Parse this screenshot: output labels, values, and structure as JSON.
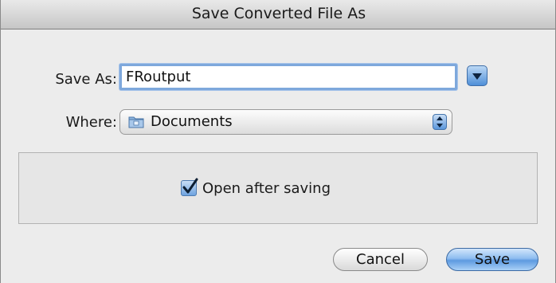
{
  "window": {
    "title": "Save Converted File As"
  },
  "form": {
    "save_as_label": "Save As:",
    "filename_value": "FRoutput",
    "where_label": "Where:",
    "where_value": "Documents",
    "folder_icon": "folder-icon",
    "disclosure_icon": "chevron-down-icon",
    "popup_icon": "up-down-stepper-icon"
  },
  "options": {
    "open_after_saving_label": "Open after saving",
    "open_after_saving_checked": true
  },
  "buttons": {
    "cancel_label": "Cancel",
    "save_label": "Save"
  },
  "colors": {
    "accent": "#5d9ae0",
    "focus_ring": "#7ea8dc",
    "window_bg": "#ececec"
  }
}
